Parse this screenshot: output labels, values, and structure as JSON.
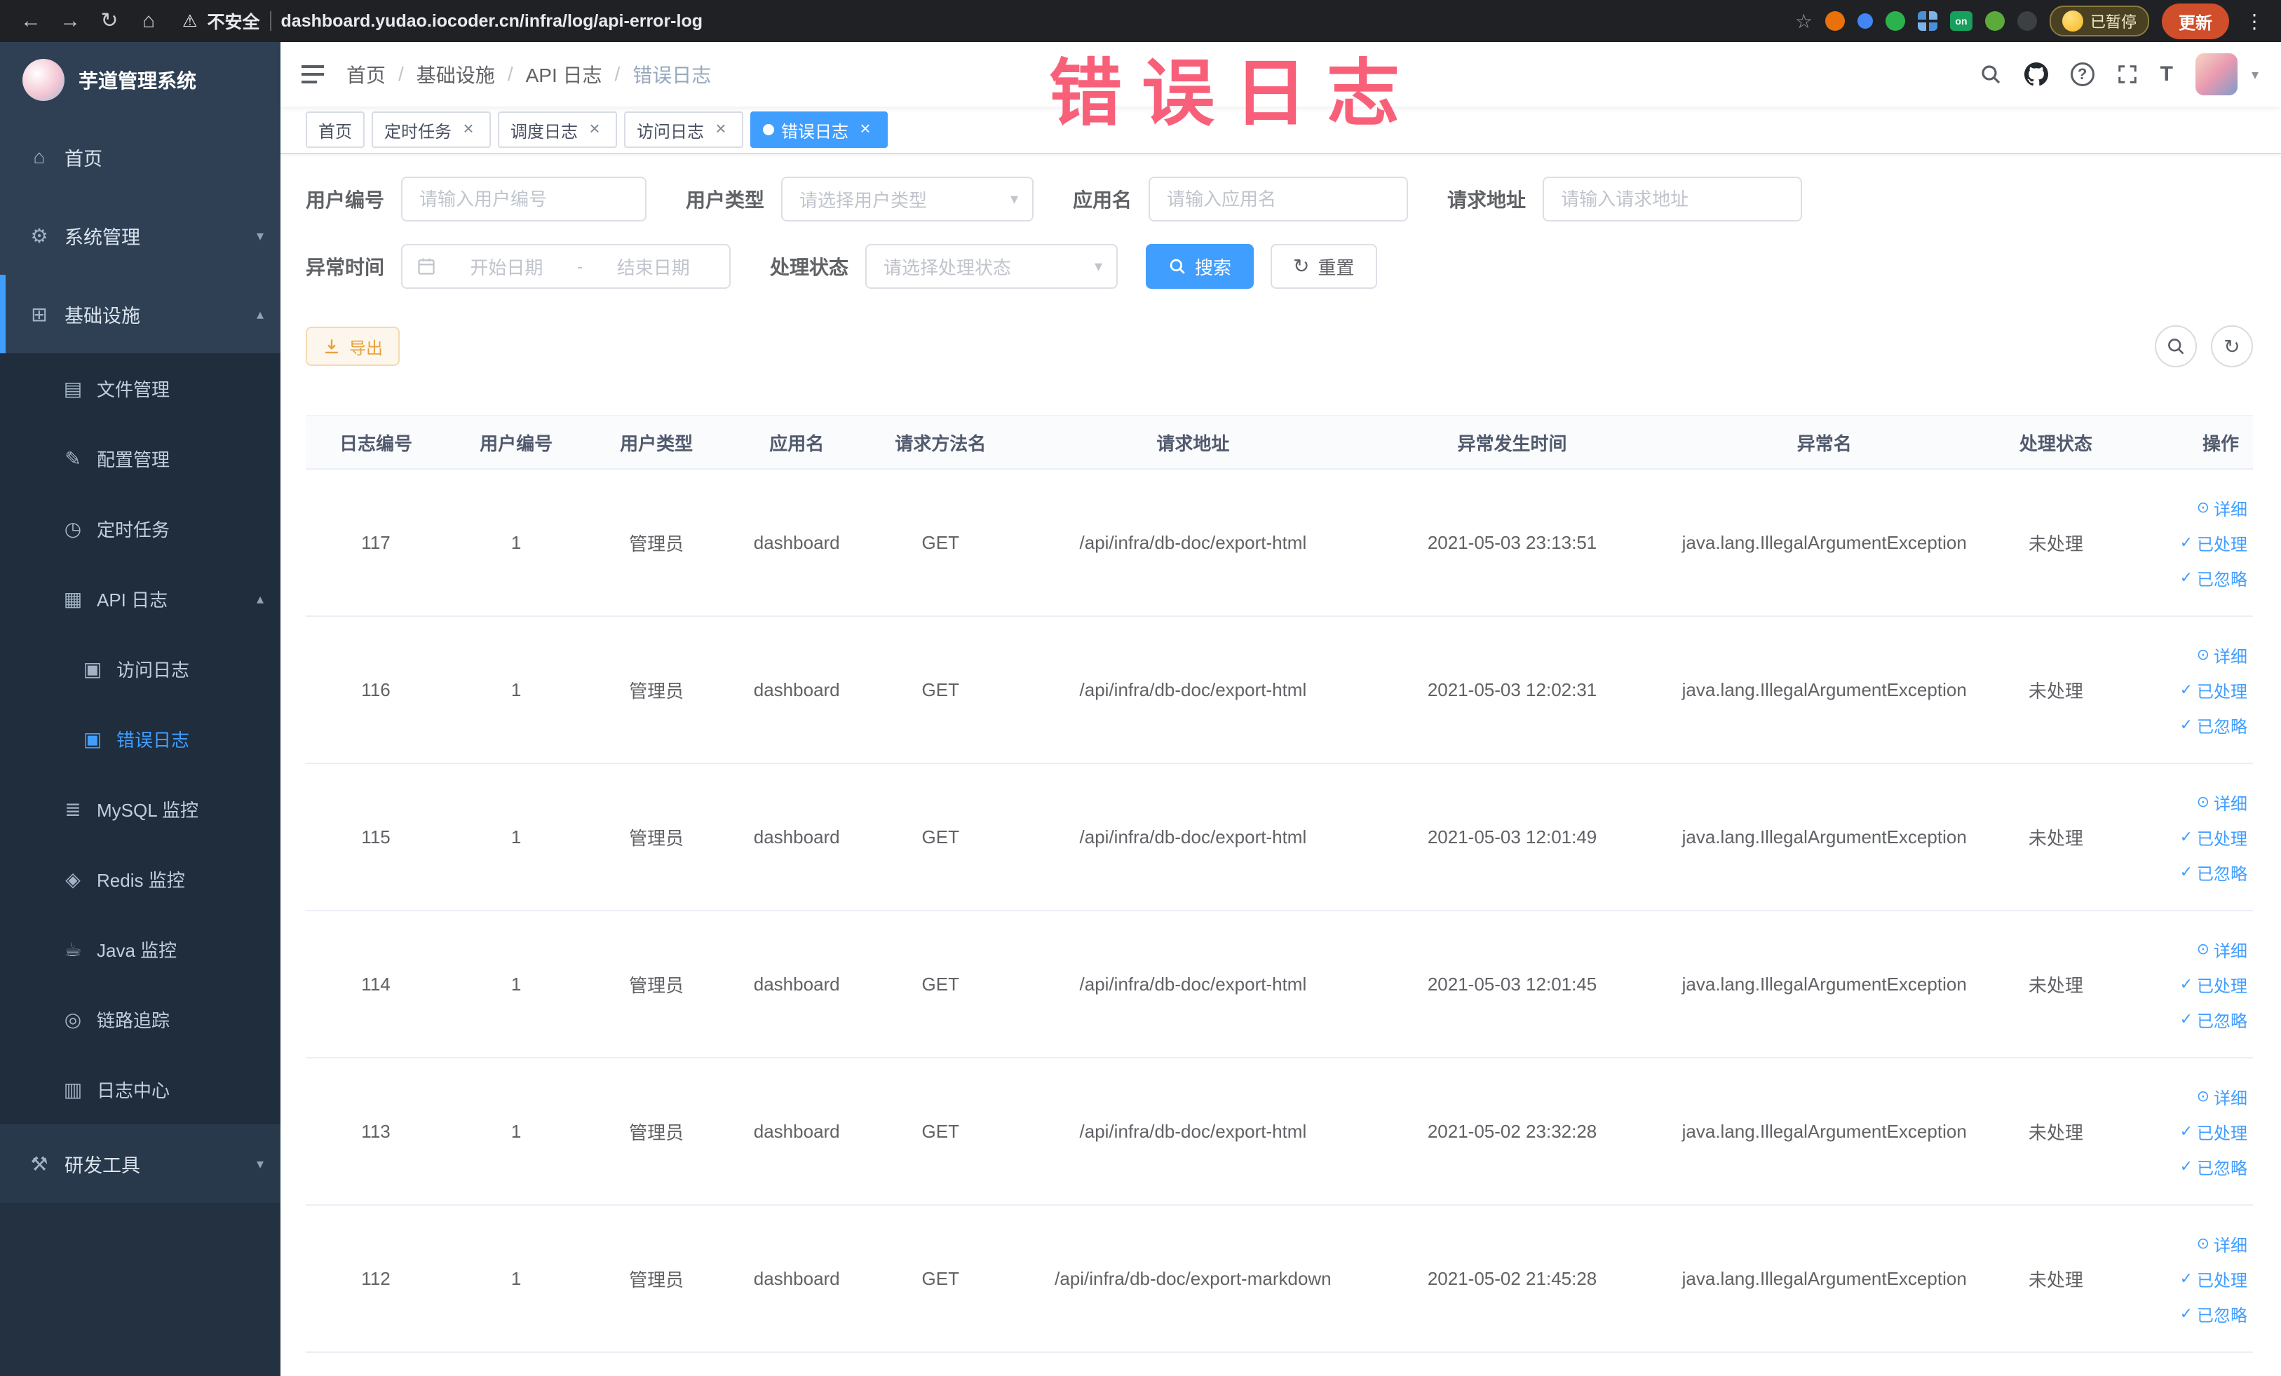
{
  "colors": {
    "accent": "#409EFF",
    "warning": "#e6a23c",
    "watermark": "#f8607a",
    "sidebar_bg": "#2f4054",
    "submenu_bg": "#1f2d3d",
    "active_tab_bg": "#409EFF"
  },
  "icons": {
    "back": "←",
    "forward": "→",
    "reload": "↻",
    "home": "⌂",
    "warning": "⚠",
    "star": "☆",
    "kebab": "⋮",
    "caret_down": "▾",
    "caret_up": "▴",
    "close": "×",
    "menu_home": "⌂",
    "menu_system": "⚙",
    "menu_infra": "⊞",
    "menu_file": "▤",
    "menu_config": "✎",
    "menu_job": "◷",
    "menu_apilog": "▦",
    "menu_accesslog": "▣",
    "menu_errorlog": "▣",
    "menu_mysql": "≣",
    "menu_redis": "◈",
    "menu_java": "☕",
    "menu_trace": "◎",
    "menu_logcenter": "▥",
    "menu_devtools": "⚒",
    "question": "?",
    "font_size": "T",
    "refresh": "↻",
    "eye": "⊙",
    "check": "✓"
  },
  "browser": {
    "security_label": "不安全",
    "url": "dashboard.yudao.iocoder.cn/infra/log/api-error-log",
    "paused_badge": "已暂停",
    "update_button": "更新",
    "extension_on_label": "on"
  },
  "sidebar": {
    "logo_title": "芋道管理系统",
    "home": "首页",
    "system": "系统管理",
    "infra": "基础设施",
    "file": "文件管理",
    "config": "配置管理",
    "job": "定时任务",
    "apilog": "API 日志",
    "accesslog": "访问日志",
    "errorlog": "错误日志",
    "mysql": "MySQL 监控",
    "redis": "Redis 监控",
    "java": "Java 监控",
    "trace": "链路追踪",
    "logcenter": "日志中心",
    "devtools": "研发工具"
  },
  "breadcrumb": {
    "separator": "/",
    "items": [
      "首页",
      "基础设施",
      "API 日志",
      "错误日志"
    ]
  },
  "tabs": [
    {
      "label": "首页"
    },
    {
      "label": "定时任务"
    },
    {
      "label": "调度日志"
    },
    {
      "label": "访问日志"
    },
    {
      "label": "错误日志"
    }
  ],
  "watermark": "错误日志",
  "filters": {
    "user_id_label": "用户编号",
    "user_id_placeholder": "请输入用户编号",
    "user_type_label": "用户类型",
    "user_type_placeholder": "请选择用户类型",
    "app_name_label": "应用名",
    "app_name_placeholder": "请输入应用名",
    "request_url_label": "请求地址",
    "request_url_placeholder": "请输入请求地址",
    "exception_time_label": "异常时间",
    "date_start_placeholder": "开始日期",
    "date_separator": "-",
    "date_end_placeholder": "结束日期",
    "process_status_label": "处理状态",
    "process_status_placeholder": "请选择处理状态",
    "search_button": "搜索",
    "reset_button": "重置"
  },
  "toolbar": {
    "export_button": "导出"
  },
  "table": {
    "columns": [
      "日志编号",
      "用户编号",
      "用户类型",
      "应用名",
      "请求方法名",
      "请求地址",
      "异常发生时间",
      "异常名",
      "处理状态",
      "操作"
    ],
    "row_actions": [
      "详细",
      "已处理",
      "已忽略"
    ],
    "rows": [
      {
        "id": "117",
        "user_id": "1",
        "user_type": "管理员",
        "app_name": "dashboard",
        "method": "GET",
        "url": "/api/infra/db-doc/export-html",
        "time": "2021-05-03 23:13:51",
        "exception": "java.lang.IllegalArgumentException",
        "status": "未处理"
      },
      {
        "id": "116",
        "user_id": "1",
        "user_type": "管理员",
        "app_name": "dashboard",
        "method": "GET",
        "url": "/api/infra/db-doc/export-html",
        "time": "2021-05-03 12:02:31",
        "exception": "java.lang.IllegalArgumentException",
        "status": "未处理"
      },
      {
        "id": "115",
        "user_id": "1",
        "user_type": "管理员",
        "app_name": "dashboard",
        "method": "GET",
        "url": "/api/infra/db-doc/export-html",
        "time": "2021-05-03 12:01:49",
        "exception": "java.lang.IllegalArgumentException",
        "status": "未处理"
      },
      {
        "id": "114",
        "user_id": "1",
        "user_type": "管理员",
        "app_name": "dashboard",
        "method": "GET",
        "url": "/api/infra/db-doc/export-html",
        "time": "2021-05-03 12:01:45",
        "exception": "java.lang.IllegalArgumentException",
        "status": "未处理"
      },
      {
        "id": "113",
        "user_id": "1",
        "user_type": "管理员",
        "app_name": "dashboard",
        "method": "GET",
        "url": "/api/infra/db-doc/export-html",
        "time": "2021-05-02 23:32:28",
        "exception": "java.lang.IllegalArgumentException",
        "status": "未处理"
      },
      {
        "id": "112",
        "user_id": "1",
        "user_type": "管理员",
        "app_name": "dashboard",
        "method": "GET",
        "url": "/api/infra/db-doc/export-markdown",
        "time": "2021-05-02 21:45:28",
        "exception": "java.lang.IllegalArgumentException",
        "status": "未处理"
      }
    ]
  }
}
